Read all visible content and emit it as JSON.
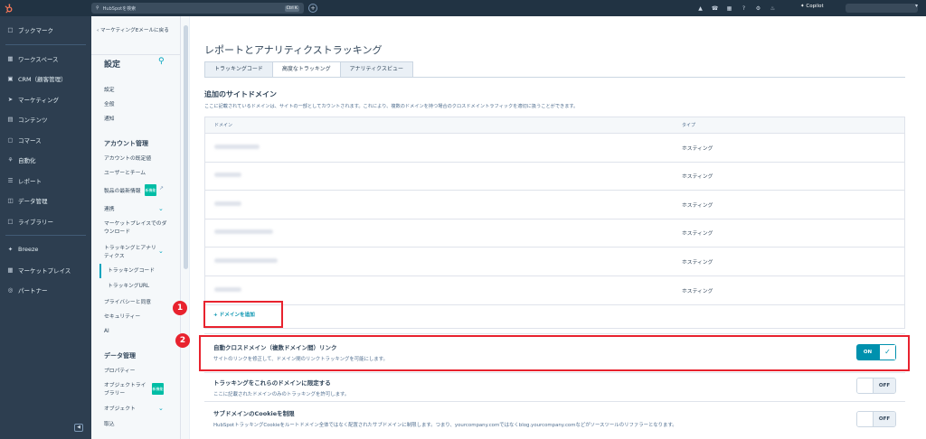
{
  "topbar": {
    "search_placeholder": "HubSpotを検索",
    "shortcut": "Ctrl K",
    "copilot": "Copilot"
  },
  "leftnav": {
    "items": [
      {
        "label": "ブックマーク",
        "icon": "bookmark-icon"
      },
      {
        "label": "ワークスペース",
        "icon": "workspace-icon"
      },
      {
        "label": "CRM（顧客管理）",
        "icon": "crm-icon"
      },
      {
        "label": "マーケティング",
        "icon": "marketing-icon"
      },
      {
        "label": "コンテンツ",
        "icon": "content-icon"
      },
      {
        "label": "コマース",
        "icon": "commerce-icon"
      },
      {
        "label": "自動化",
        "icon": "automation-icon"
      },
      {
        "label": "レポート",
        "icon": "reports-icon"
      },
      {
        "label": "データ管理",
        "icon": "data-icon"
      },
      {
        "label": "ライブラリー",
        "icon": "library-icon"
      },
      {
        "label": "Breeze",
        "icon": "breeze-icon"
      },
      {
        "label": "マーケットプレイス",
        "icon": "marketplace-icon"
      },
      {
        "label": "パートナー",
        "icon": "partner-icon"
      }
    ]
  },
  "settings_panel": {
    "back": "マーケティングEメールに戻る",
    "title": "設定",
    "items": {
      "settings": "設定",
      "general": "全般",
      "notifications": "通知",
      "account_mgmt": "アカウント管理",
      "account_defaults": "アカウントの既定値",
      "users_teams": "ユーザーとチーム",
      "product_updates": "製品の最新情報",
      "integrations": "連携",
      "marketplace_downloads": "マーケットプレイスでのダウンロード",
      "tracking_analytics": "トラッキングとアナリティクス",
      "tracking_code": "トラッキングコード",
      "tracking_url": "トラッキングURL",
      "privacy_consent": "プライバシーと同意",
      "security": "セキュリティー",
      "ai": "AI",
      "data_mgmt": "データ管理",
      "properties": "プロパティー",
      "object_library": "オブジェクトライブラリー",
      "objects": "オブジェクト",
      "import": "取込"
    },
    "beta_label": "新機能"
  },
  "main": {
    "page_title": "レポートとアナリティクストラッキング",
    "tabs": [
      "トラッキングコード",
      "高度なトラッキング",
      "アナリティクスビュー"
    ],
    "section_title": "追加のサイトドメイン",
    "section_desc": "ここに記載されているドメインは、サイトの一部としてカウントされます。これにより、複数のドメインを持つ場合のクロスドメイントラフィックを適切に扱うことができます。",
    "table": {
      "headers": [
        "ドメイン",
        "タイプ"
      ],
      "rows": [
        {
          "type": "ホスティング"
        },
        {
          "type": "ホスティング"
        },
        {
          "type": "ホスティング"
        },
        {
          "type": "ホスティング"
        },
        {
          "type": "ホスティング"
        },
        {
          "type": "ホスティング"
        }
      ]
    },
    "add_domain": "+ ドメインを追加",
    "settings": [
      {
        "title": "自動クロスドメイン（複数ドメイン間）リンク",
        "desc": "サイトのリンクを修正して、ドメイン間のリンクトラッキングを可能にします。",
        "state": "ON"
      },
      {
        "title": "トラッキングをこれらのドメインに限定する",
        "desc": "ここに記載されたドメインのみのトラッキングを許可します。",
        "state": "OFF"
      },
      {
        "title": "サブドメインのCookieを制限",
        "desc": "HubSpotトラッキングCookieをルートドメイン全体ではなく配置されたサブドメインに制限します。つまり、yourcompany.comではなくblog.yourcompany.comなどがソースツールのリファラーとなります。",
        "state": "OFF"
      }
    ],
    "callouts": [
      "1",
      "2"
    ]
  },
  "colors": {
    "accent": "#0091ae",
    "callout": "#e8222e",
    "nav_bg": "#2d3e50",
    "topbar_bg": "#213343"
  }
}
